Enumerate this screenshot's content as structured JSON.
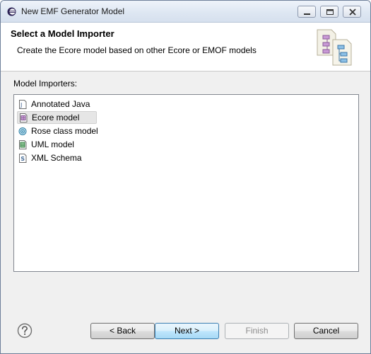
{
  "window": {
    "title": "New EMF Generator Model"
  },
  "header": {
    "title": "Select a Model Importer",
    "description": "Create the Ecore model based on other Ecore or EMOF models"
  },
  "importers": {
    "label": "Model Importers:",
    "selected_index": 1,
    "items": [
      {
        "label": "Annotated Java",
        "icon": "java-file-icon"
      },
      {
        "label": "Ecore model",
        "icon": "ecore-icon"
      },
      {
        "label": "Rose class model",
        "icon": "rose-icon"
      },
      {
        "label": "UML model",
        "icon": "uml-icon"
      },
      {
        "label": "XML Schema",
        "icon": "xml-schema-icon"
      }
    ]
  },
  "buttons": {
    "back": "< Back",
    "next": "Next >",
    "finish": "Finish",
    "cancel": "Cancel"
  },
  "colors": {
    "selection": "#e6e6e6",
    "next_border": "#3c7fb1",
    "disabled_text": "#8d8d8d"
  }
}
